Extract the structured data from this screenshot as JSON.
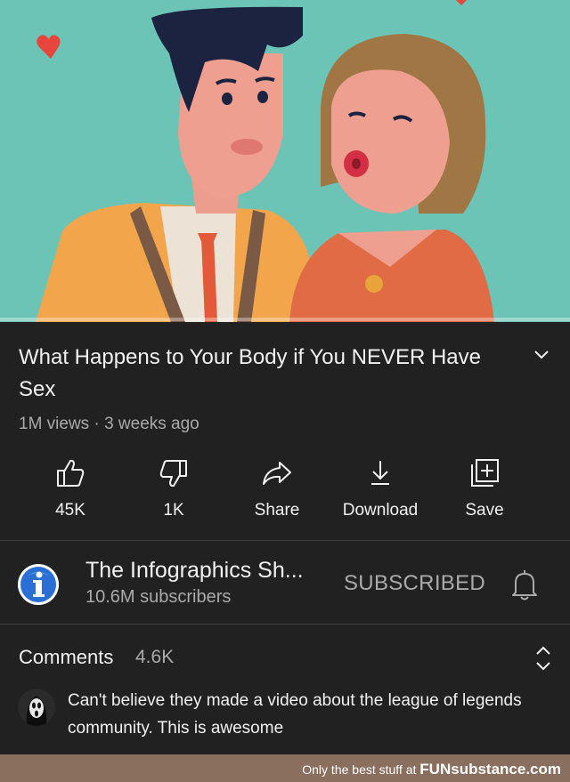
{
  "video": {
    "progress": 0.0
  },
  "title": "What Happens to Your Body if You NEVER Have Sex",
  "meta": "1M views · 3 weeks ago",
  "actions": [
    {
      "label": "45K",
      "icon": "thumbs-up-icon"
    },
    {
      "label": "1K",
      "icon": "thumbs-down-icon"
    },
    {
      "label": "Share",
      "icon": "share-icon"
    },
    {
      "label": "Download",
      "icon": "download-icon"
    },
    {
      "label": "Save",
      "icon": "save-playlist-icon"
    }
  ],
  "channel": {
    "name": "The Infographics Sh...",
    "subscribers": "10.6M subscribers",
    "subscribe_label": "SUBSCRIBED",
    "avatar_letter": "i"
  },
  "comments": {
    "title": "Comments",
    "count": "4.6K",
    "top_comment": "Can't believe they made a video about the league of legends community. This is awesome"
  },
  "watermark": {
    "text": "Only the best stuff at",
    "brand": "FUNsubstance.com"
  },
  "colors": {
    "background": "#212121",
    "video_bg": "#6cc4b6",
    "progress_red": "#e0211b",
    "secondary_text": "#aaaaaa",
    "watermark_bg": "#8a6f5e"
  }
}
